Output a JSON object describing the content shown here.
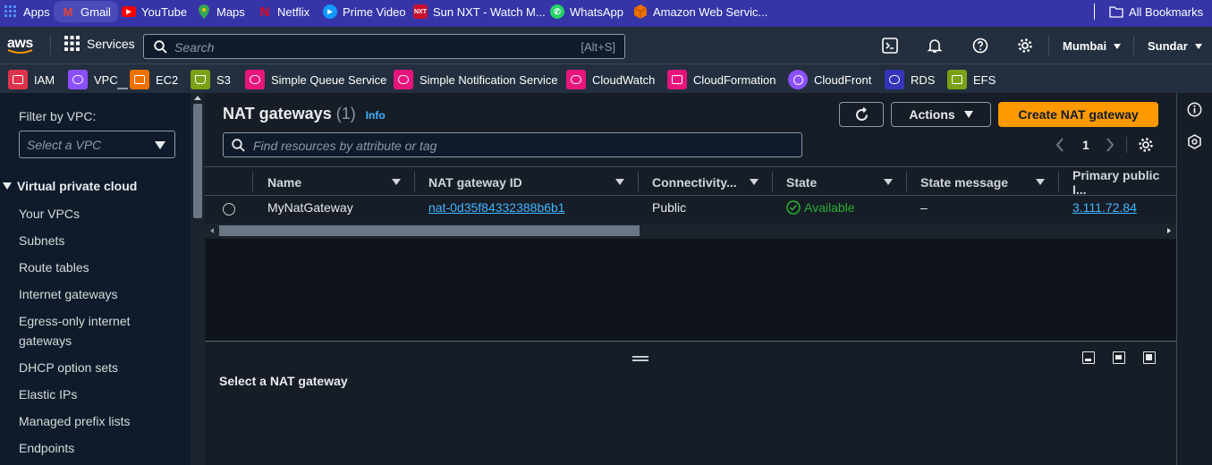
{
  "bookmarks": {
    "items": [
      {
        "label": "Apps"
      },
      {
        "label": "Gmail"
      },
      {
        "label": "YouTube"
      },
      {
        "label": "Maps"
      },
      {
        "label": "Netflix"
      },
      {
        "label": "Prime Video"
      },
      {
        "label": "Sun NXT - Watch M..."
      },
      {
        "label": "WhatsApp"
      },
      {
        "label": "Amazon Web Servic..."
      }
    ],
    "all_bookmarks": "All Bookmarks"
  },
  "topnav": {
    "logo": "aws",
    "services": "Services",
    "search_placeholder": "Search",
    "search_shortcut": "[Alt+S]",
    "region": "Mumbai",
    "user": "Sundar"
  },
  "favorites": [
    {
      "label": "IAM",
      "color": "#dd344c"
    },
    {
      "label": "VPC",
      "color": "#8c4fff"
    },
    {
      "label": "EC2",
      "color": "#ed7100"
    },
    {
      "label": "S3",
      "color": "#7aa116"
    },
    {
      "label": "Simple Queue Service",
      "color": "#e7157b"
    },
    {
      "label": "Simple Notification Service",
      "color": "#e7157b"
    },
    {
      "label": "CloudWatch",
      "color": "#e7157b"
    },
    {
      "label": "CloudFormation",
      "color": "#e7157b"
    },
    {
      "label": "CloudFront",
      "color": "#8c4fff"
    },
    {
      "label": "RDS",
      "color": "#3334b9"
    },
    {
      "label": "EFS",
      "color": "#7aa116"
    }
  ],
  "sidebar": {
    "filter_label": "Filter by VPC:",
    "filter_placeholder": "Select a VPC",
    "section": "Virtual private cloud",
    "items": [
      {
        "label": "Your VPCs"
      },
      {
        "label": "Subnets"
      },
      {
        "label": "Route tables"
      },
      {
        "label": "Internet gateways"
      },
      {
        "label": "Egress-only internet"
      },
      {
        "label": "gateways"
      },
      {
        "label": "DHCP option sets"
      },
      {
        "label": "Elastic IPs"
      },
      {
        "label": "Managed prefix lists"
      },
      {
        "label": "Endpoints"
      }
    ]
  },
  "main": {
    "title": "NAT gateways",
    "count": "(1)",
    "info": "Info",
    "actions": "Actions",
    "create": "Create NAT gateway",
    "search_placeholder": "Find resources by attribute or tag",
    "page": "1",
    "columns": [
      "Name",
      "NAT gateway ID",
      "Connectivity...",
      "State",
      "State message",
      "Primary public I..."
    ],
    "row": {
      "name": "MyNatGateway",
      "id": "nat-0d35f84332388b6b1",
      "connectivity": "Public",
      "state": "Available",
      "state_message": "–",
      "public_ip": "3.111.72.84"
    },
    "detail_title": "Select a NAT gateway"
  }
}
